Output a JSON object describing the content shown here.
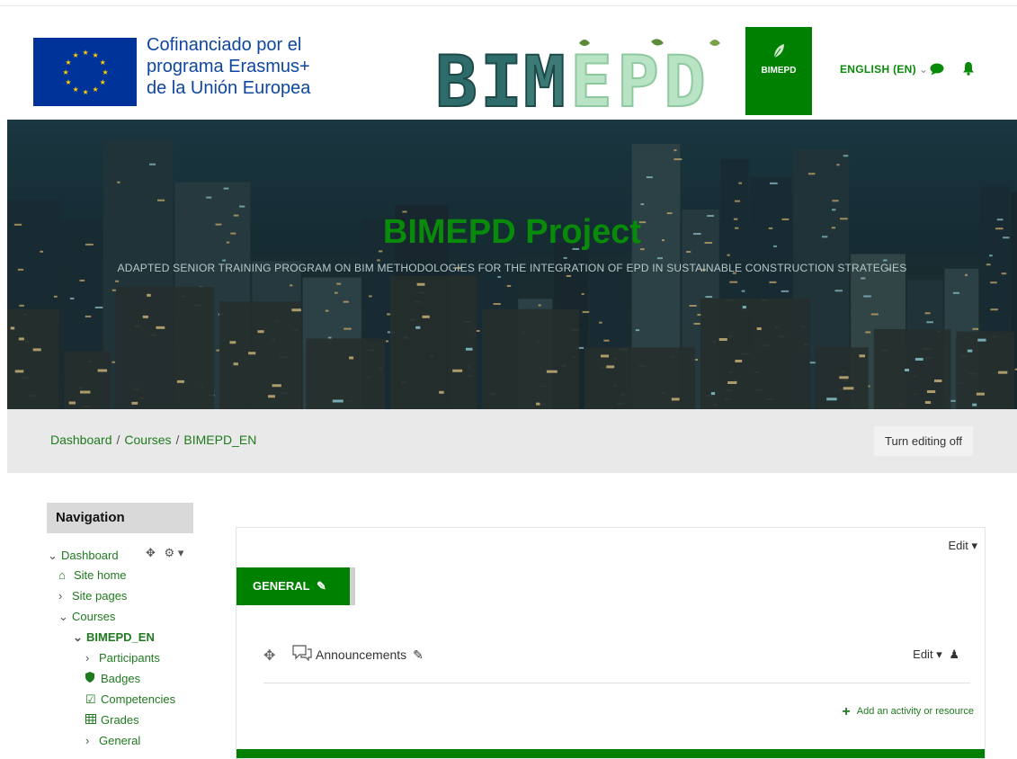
{
  "header": {
    "eu_lines": [
      "Cofinanciado por el",
      "programa Erasmus+",
      "de la Unión Europea"
    ],
    "logo_badge": "BIMEPD",
    "language": "ENGLISH (EN)",
    "icons": [
      "chat-icon",
      "bell-icon"
    ],
    "brand_color": "#008000"
  },
  "hero": {
    "title": "BIMEPD Project",
    "subtitle": "ADAPTED SENIOR TRAINING PROGRAM ON BIM METHODOLOGIES FOR THE INTEGRATION OF EPD IN SUSTAINABLE CONSTRUCTION STRATEGIES"
  },
  "breadcrumb": [
    "Dashboard",
    "Courses",
    "BIMEPD_EN"
  ],
  "breadcrumb_sep": "/",
  "edit_toggle": "Turn editing off",
  "navigation": {
    "title": "Navigation",
    "items": [
      {
        "label": "Dashboard",
        "icon": "chevron-down"
      },
      {
        "label": "Site home",
        "icon": "home-icon"
      },
      {
        "label": "Site pages",
        "icon": "chevron-right"
      },
      {
        "label": "Courses",
        "icon": "chevron-down"
      },
      {
        "label": "BIMEPD_EN",
        "icon": "chevron-down"
      },
      {
        "label": "Participants",
        "icon": "chevron-right"
      },
      {
        "label": "Badges",
        "icon": "shield-icon"
      },
      {
        "label": "Competencies",
        "icon": "checkbox-icon"
      },
      {
        "label": "Grades",
        "icon": "table-icon"
      },
      {
        "label": "General",
        "icon": "chevron-right"
      }
    ]
  },
  "course": {
    "panel_edit": "Edit",
    "section_tab": "GENERAL",
    "activity_name": "Announcements",
    "activity_edit": "Edit",
    "add_activity": "Add an activity or resource"
  }
}
